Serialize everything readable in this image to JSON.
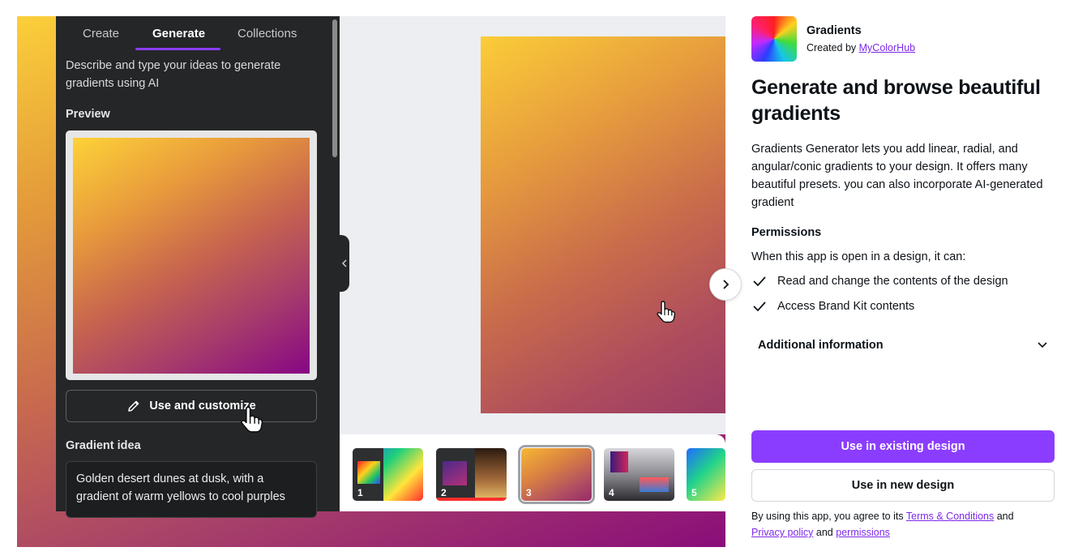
{
  "panel": {
    "tabs": [
      "Create",
      "Generate",
      "Collections"
    ],
    "active_tab": "Generate",
    "description": "Describe and type your ideas to generate gradients using AI",
    "preview_heading": "Preview",
    "customize_label": "Use and customize",
    "idea_heading": "Gradient idea",
    "idea_text": "Golden desert dunes at dusk, with a gradient of warm yellows to cool purples"
  },
  "thumbnails": [
    {
      "number": "1"
    },
    {
      "number": "2"
    },
    {
      "number": "3",
      "selected": true
    },
    {
      "number": "4"
    },
    {
      "number": "5"
    }
  ],
  "app": {
    "name": "Gradients",
    "created_by_prefix": "Created by",
    "creator": "MyColorHub",
    "title": "Generate and browse beautiful gradients",
    "description": "Gradients Generator lets you add linear, radial, and angular/conic gradients to your design. It offers many beautiful presets. you can also incorporate AI-generated gradient"
  },
  "permissions": {
    "title": "Permissions",
    "intro": "When this app is open in a design, it can:",
    "items": [
      "Read and change the contents of the design",
      "Access Brand Kit contents"
    ]
  },
  "additional_info": "Additional information",
  "actions": {
    "existing": "Use in existing design",
    "new": "Use in new design"
  },
  "legal": {
    "prefix": "By using this app, you agree to its",
    "terms": "Terms & Conditions",
    "and1": "and",
    "privacy": "Privacy policy",
    "and2": "and",
    "permissions": "permissions"
  },
  "colors": {
    "accent": "#8b3dff",
    "link": "#7d2ae8"
  }
}
